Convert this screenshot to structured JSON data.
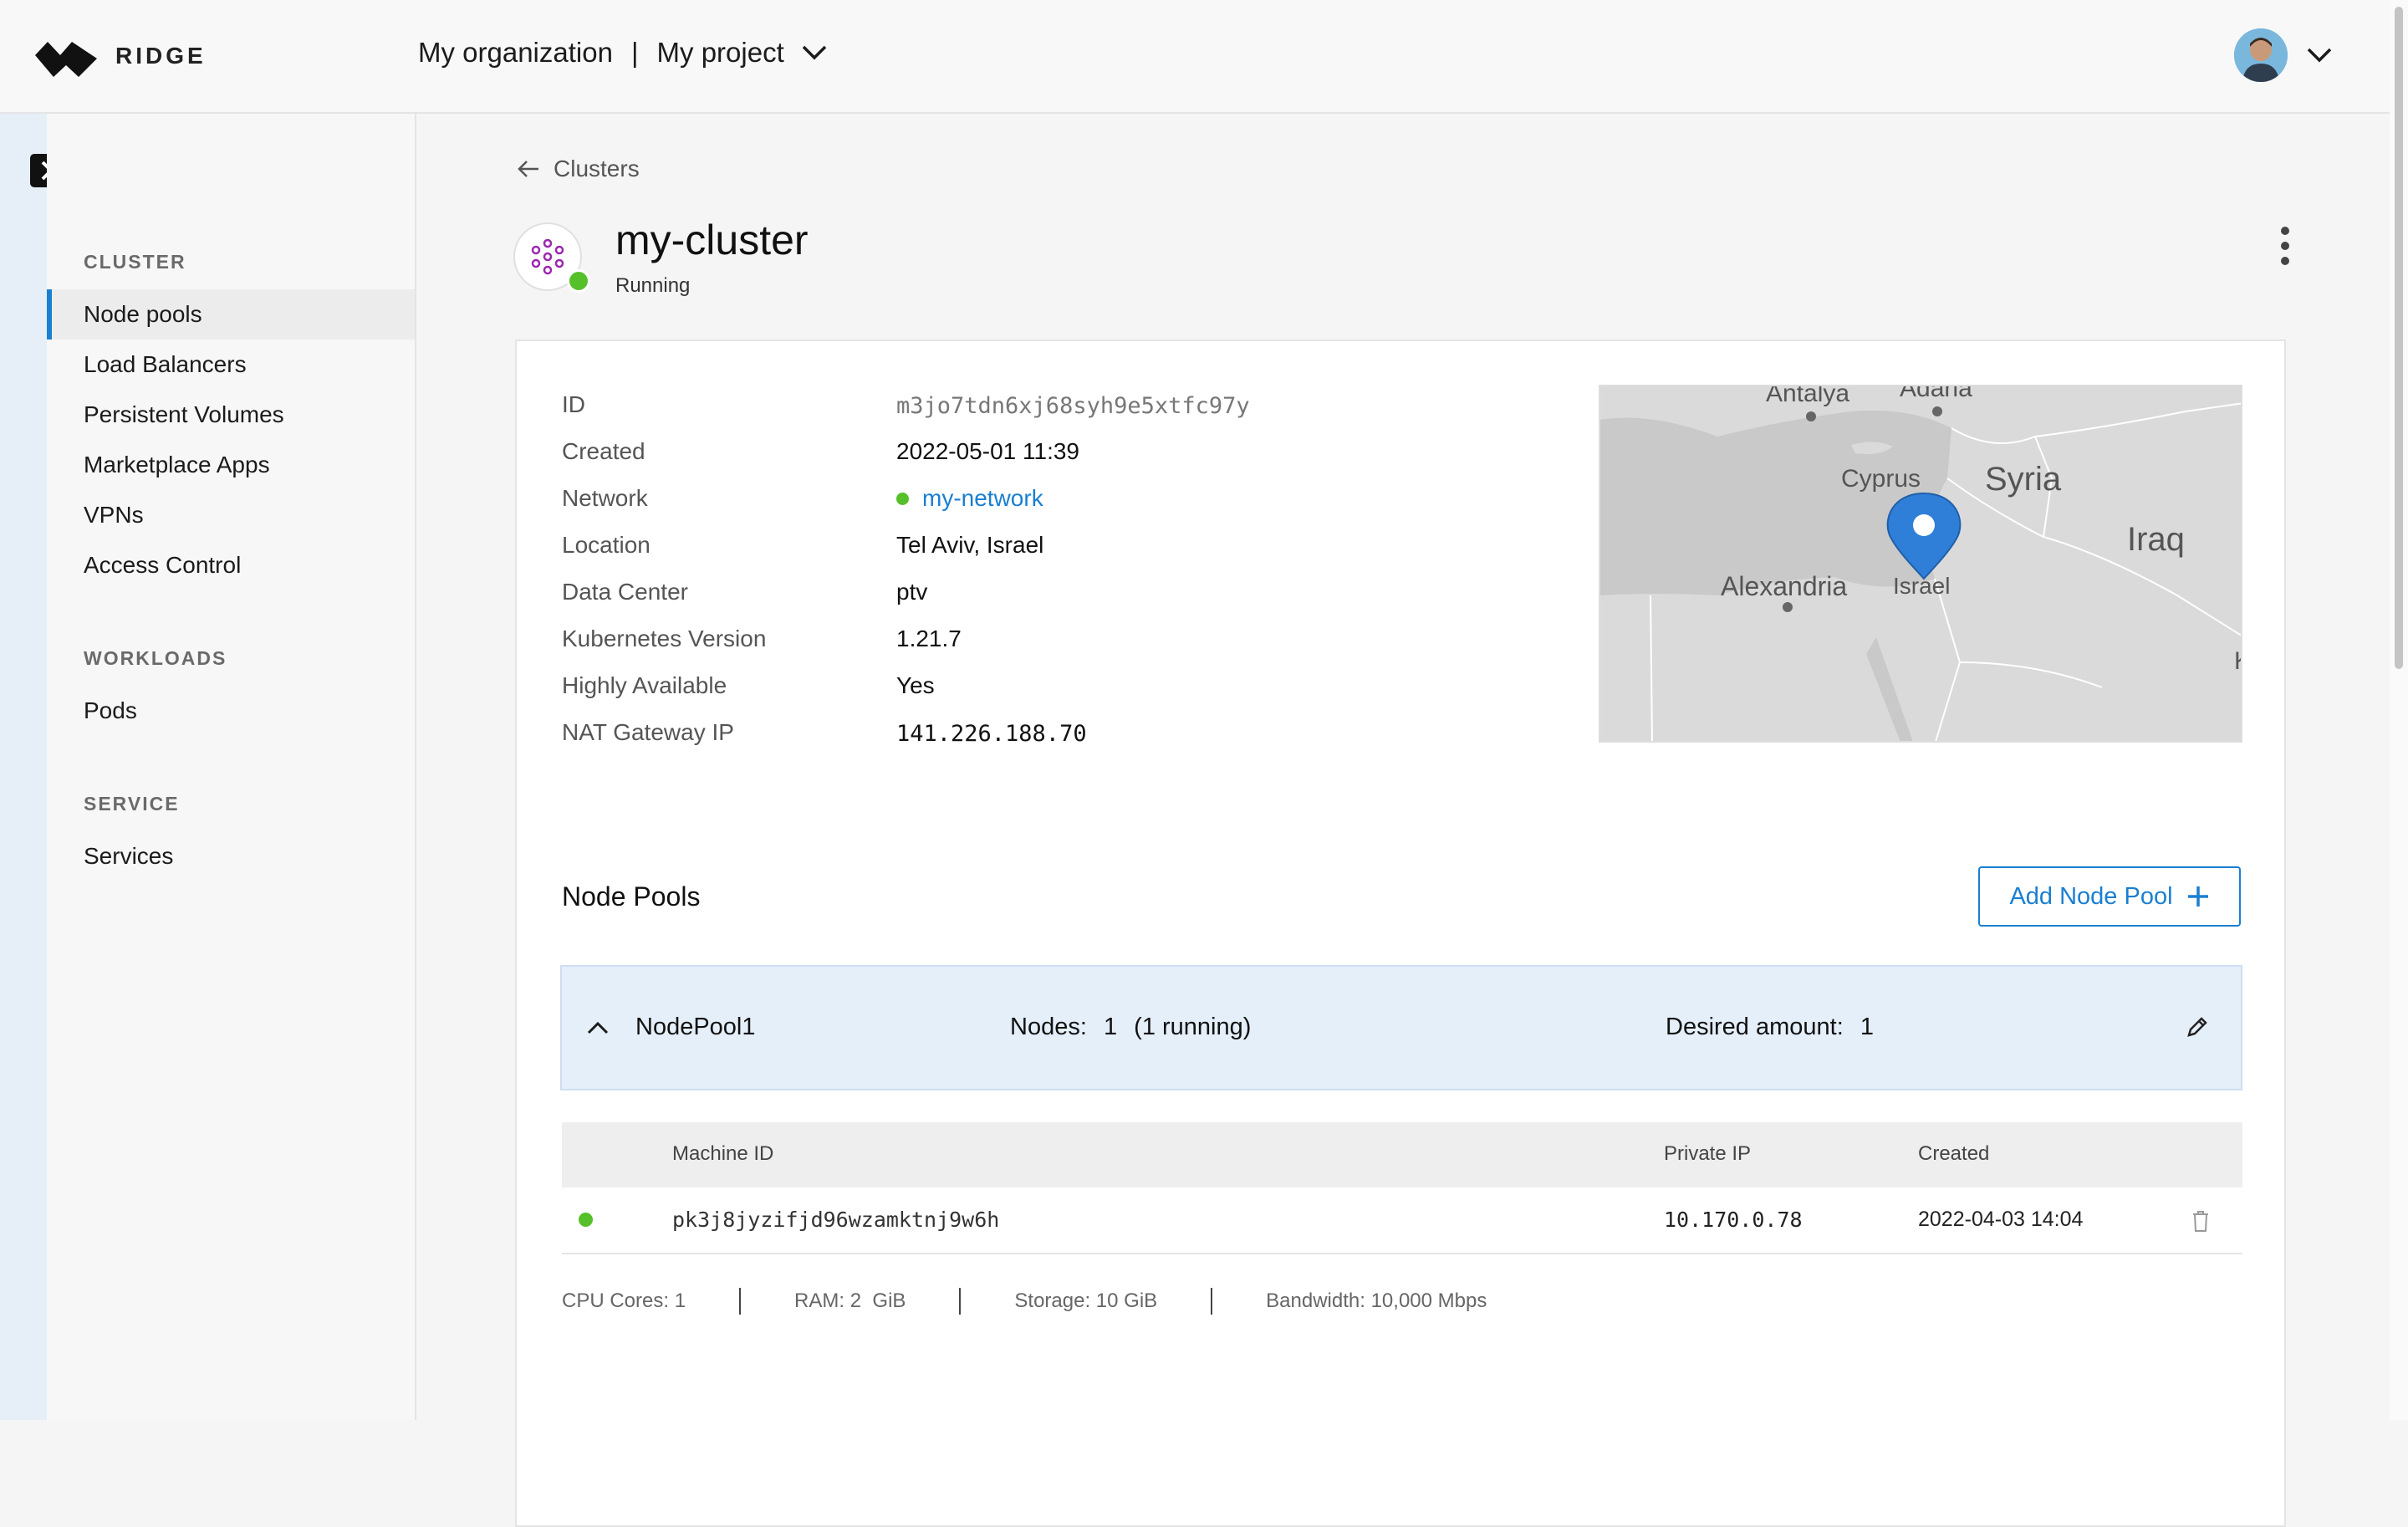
{
  "header": {
    "logo_text": "RIDGE",
    "organization": "My organization",
    "separator": "|",
    "project": "My project"
  },
  "sidebar": {
    "sections": [
      {
        "title": "CLUSTER",
        "items": [
          "Node pools",
          "Load Balancers",
          "Persistent Volumes",
          "Marketplace Apps",
          "VPNs",
          "Access Control"
        ]
      },
      {
        "title": "WORKLOADS",
        "items": [
          "Pods"
        ]
      },
      {
        "title": "SERVICE",
        "items": [
          "Services"
        ]
      }
    ],
    "active_item": "Node pools"
  },
  "breadcrumb": {
    "back_label": "Clusters"
  },
  "cluster": {
    "name": "my-cluster",
    "status": "Running",
    "status_color": "#56c02b"
  },
  "details": {
    "labels": [
      "ID",
      "Created",
      "Network",
      "Location",
      "Data Center",
      "Kubernetes Version",
      "Highly Available",
      "NAT Gateway IP"
    ],
    "id": "m3jo7tdn6xj68syh9e5xtfc97y",
    "created": "2022-05-01 11:39",
    "network": "my-network",
    "location": "Tel Aviv, Israel",
    "data_center": "ptv",
    "k8s_version": "1.21.7",
    "highly_available": "Yes",
    "nat_ip": "141.226.188.70"
  },
  "map": {
    "labels": [
      "Antalya",
      "Adana",
      "Cyprus",
      "Syria",
      "Iraq",
      "Alexandria",
      "Israel",
      "K"
    ]
  },
  "node_pools": {
    "title": "Node Pools",
    "add_label": "Add Node Pool",
    "pool": {
      "name": "NodePool1",
      "nodes_label": "Nodes:",
      "nodes_value": "1",
      "nodes_running": "(1 running)",
      "desired_label": "Desired amount:",
      "desired_value": "1"
    },
    "table": {
      "headers": [
        "Machine ID",
        "Private IP",
        "Created"
      ],
      "rows": [
        {
          "machine_id": "pk3j8jyzifjd96wzamktnj9w6h",
          "private_ip": "10.170.0.78",
          "created": "2022-04-03 14:04"
        }
      ]
    },
    "specs": [
      "CPU Cores: 1",
      "RAM: 2  GiB",
      "Storage: 10 GiB",
      "Bandwidth: 10,000 Mbps"
    ]
  },
  "colors": {
    "accent": "#1a7fd1",
    "status_green": "#56c02b",
    "pool_row_bg": "#e5eff9",
    "cluster_icon": "#9c27b0"
  }
}
